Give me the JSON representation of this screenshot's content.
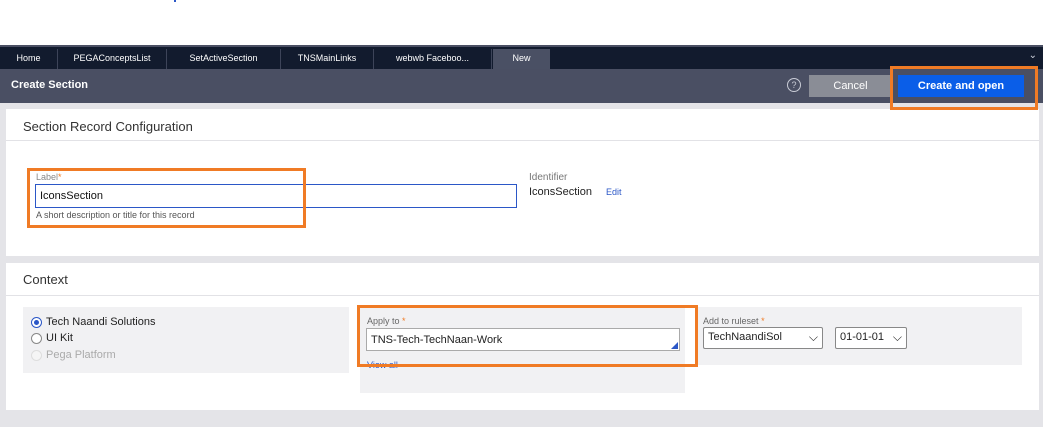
{
  "tabs": [
    {
      "label": "Home"
    },
    {
      "label": "PEGAConceptsList"
    },
    {
      "label": "SetActiveSection"
    },
    {
      "label": "TNSMainLinks"
    },
    {
      "label": "webwb Faceboo..."
    },
    {
      "label": "New",
      "active": true
    }
  ],
  "header": {
    "title": "Create Section",
    "help_icon": "question-circle-icon",
    "cancel_label": "Cancel",
    "create_label": "Create and open"
  },
  "record_config": {
    "title": "Section Record Configuration",
    "label_field": {
      "label": "Label",
      "value": "IconsSection",
      "help": "A short description or title for this record"
    },
    "identifier": {
      "label": "Identifier",
      "value": "IconsSection",
      "edit_label": "Edit"
    }
  },
  "context": {
    "title": "Context",
    "options": [
      {
        "label": "Tech Naandi Solutions",
        "selected": true
      },
      {
        "label": "UI Kit",
        "selected": false
      },
      {
        "label": "Pega Platform",
        "selected": false,
        "disabled": true
      }
    ],
    "apply_to": {
      "label": "Apply to",
      "value": "TNS-Tech-TechNaan-Work",
      "view_all": "View all"
    },
    "ruleset": {
      "label": "Add to ruleset",
      "value": "TechNaandiSol",
      "version": "01-01-01"
    }
  },
  "colors": {
    "highlight": "#f07b25",
    "primary": "#0a5ee8",
    "tabbar": "#121b2e",
    "header": "#4a4f63"
  }
}
